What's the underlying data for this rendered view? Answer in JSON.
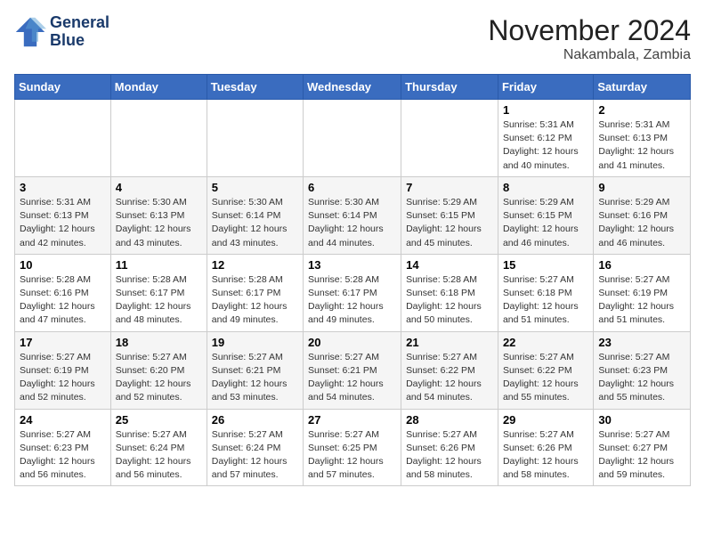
{
  "logo": {
    "line1": "General",
    "line2": "Blue"
  },
  "title": "November 2024",
  "location": "Nakambala, Zambia",
  "days_header": [
    "Sunday",
    "Monday",
    "Tuesday",
    "Wednesday",
    "Thursday",
    "Friday",
    "Saturday"
  ],
  "weeks": [
    [
      {
        "day": "",
        "info": ""
      },
      {
        "day": "",
        "info": ""
      },
      {
        "day": "",
        "info": ""
      },
      {
        "day": "",
        "info": ""
      },
      {
        "day": "",
        "info": ""
      },
      {
        "day": "1",
        "info": "Sunrise: 5:31 AM\nSunset: 6:12 PM\nDaylight: 12 hours\nand 40 minutes."
      },
      {
        "day": "2",
        "info": "Sunrise: 5:31 AM\nSunset: 6:13 PM\nDaylight: 12 hours\nand 41 minutes."
      }
    ],
    [
      {
        "day": "3",
        "info": "Sunrise: 5:31 AM\nSunset: 6:13 PM\nDaylight: 12 hours\nand 42 minutes."
      },
      {
        "day": "4",
        "info": "Sunrise: 5:30 AM\nSunset: 6:13 PM\nDaylight: 12 hours\nand 43 minutes."
      },
      {
        "day": "5",
        "info": "Sunrise: 5:30 AM\nSunset: 6:14 PM\nDaylight: 12 hours\nand 43 minutes."
      },
      {
        "day": "6",
        "info": "Sunrise: 5:30 AM\nSunset: 6:14 PM\nDaylight: 12 hours\nand 44 minutes."
      },
      {
        "day": "7",
        "info": "Sunrise: 5:29 AM\nSunset: 6:15 PM\nDaylight: 12 hours\nand 45 minutes."
      },
      {
        "day": "8",
        "info": "Sunrise: 5:29 AM\nSunset: 6:15 PM\nDaylight: 12 hours\nand 46 minutes."
      },
      {
        "day": "9",
        "info": "Sunrise: 5:29 AM\nSunset: 6:16 PM\nDaylight: 12 hours\nand 46 minutes."
      }
    ],
    [
      {
        "day": "10",
        "info": "Sunrise: 5:28 AM\nSunset: 6:16 PM\nDaylight: 12 hours\nand 47 minutes."
      },
      {
        "day": "11",
        "info": "Sunrise: 5:28 AM\nSunset: 6:17 PM\nDaylight: 12 hours\nand 48 minutes."
      },
      {
        "day": "12",
        "info": "Sunrise: 5:28 AM\nSunset: 6:17 PM\nDaylight: 12 hours\nand 49 minutes."
      },
      {
        "day": "13",
        "info": "Sunrise: 5:28 AM\nSunset: 6:17 PM\nDaylight: 12 hours\nand 49 minutes."
      },
      {
        "day": "14",
        "info": "Sunrise: 5:28 AM\nSunset: 6:18 PM\nDaylight: 12 hours\nand 50 minutes."
      },
      {
        "day": "15",
        "info": "Sunrise: 5:27 AM\nSunset: 6:18 PM\nDaylight: 12 hours\nand 51 minutes."
      },
      {
        "day": "16",
        "info": "Sunrise: 5:27 AM\nSunset: 6:19 PM\nDaylight: 12 hours\nand 51 minutes."
      }
    ],
    [
      {
        "day": "17",
        "info": "Sunrise: 5:27 AM\nSunset: 6:19 PM\nDaylight: 12 hours\nand 52 minutes."
      },
      {
        "day": "18",
        "info": "Sunrise: 5:27 AM\nSunset: 6:20 PM\nDaylight: 12 hours\nand 52 minutes."
      },
      {
        "day": "19",
        "info": "Sunrise: 5:27 AM\nSunset: 6:21 PM\nDaylight: 12 hours\nand 53 minutes."
      },
      {
        "day": "20",
        "info": "Sunrise: 5:27 AM\nSunset: 6:21 PM\nDaylight: 12 hours\nand 54 minutes."
      },
      {
        "day": "21",
        "info": "Sunrise: 5:27 AM\nSunset: 6:22 PM\nDaylight: 12 hours\nand 54 minutes."
      },
      {
        "day": "22",
        "info": "Sunrise: 5:27 AM\nSunset: 6:22 PM\nDaylight: 12 hours\nand 55 minutes."
      },
      {
        "day": "23",
        "info": "Sunrise: 5:27 AM\nSunset: 6:23 PM\nDaylight: 12 hours\nand 55 minutes."
      }
    ],
    [
      {
        "day": "24",
        "info": "Sunrise: 5:27 AM\nSunset: 6:23 PM\nDaylight: 12 hours\nand 56 minutes."
      },
      {
        "day": "25",
        "info": "Sunrise: 5:27 AM\nSunset: 6:24 PM\nDaylight: 12 hours\nand 56 minutes."
      },
      {
        "day": "26",
        "info": "Sunrise: 5:27 AM\nSunset: 6:24 PM\nDaylight: 12 hours\nand 57 minutes."
      },
      {
        "day": "27",
        "info": "Sunrise: 5:27 AM\nSunset: 6:25 PM\nDaylight: 12 hours\nand 57 minutes."
      },
      {
        "day": "28",
        "info": "Sunrise: 5:27 AM\nSunset: 6:26 PM\nDaylight: 12 hours\nand 58 minutes."
      },
      {
        "day": "29",
        "info": "Sunrise: 5:27 AM\nSunset: 6:26 PM\nDaylight: 12 hours\nand 58 minutes."
      },
      {
        "day": "30",
        "info": "Sunrise: 5:27 AM\nSunset: 6:27 PM\nDaylight: 12 hours\nand 59 minutes."
      }
    ]
  ]
}
